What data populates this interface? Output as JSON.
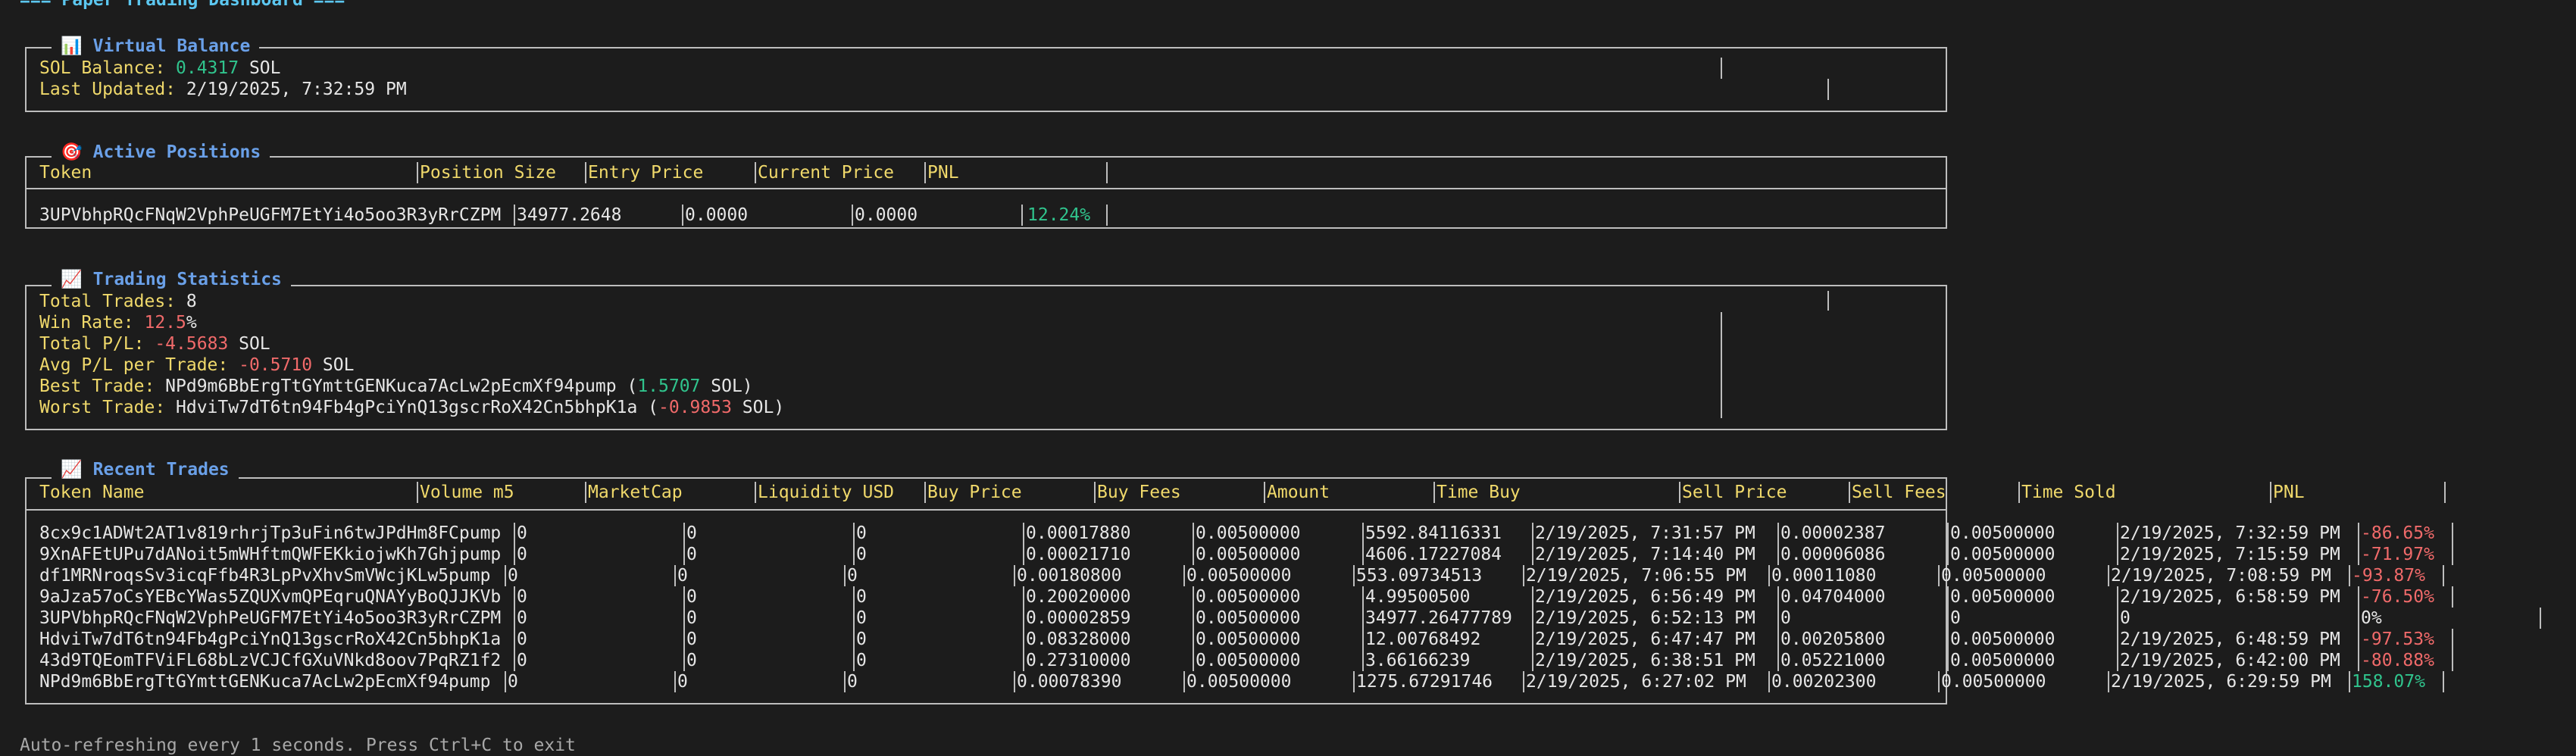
{
  "title": "=== Paper Trading Dashboard ===",
  "balance": {
    "legend": "Virtual Balance",
    "icon": "📊",
    "sol_label": "SOL Balance: ",
    "sol_value": "0.4317",
    "sol_unit": " SOL",
    "updated_label": "Last Updated: ",
    "updated_value": "2/19/2025, 7:32:59 PM"
  },
  "positions": {
    "legend": "Active Positions",
    "icon": "🎯",
    "headers": [
      "Token",
      "Position Size",
      "Entry Price",
      "Current Price",
      "PNL"
    ],
    "rows": [
      [
        "3UPVbhpRQcFNqW2VphPeUGFM7EtYi4o5oo3R3yRrCZPM",
        "34977.2648",
        "0.0000",
        "0.0000",
        "12.24%"
      ]
    ]
  },
  "stats": {
    "legend": "Trading Statistics",
    "icon": "📈",
    "total_trades_label": "Total Trades: ",
    "total_trades_value": "8",
    "win_rate_label": "Win Rate: ",
    "win_rate_value": "12.5",
    "win_rate_unit": "%",
    "total_pl_label": "Total P/L: ",
    "total_pl_value": "-4.5683",
    "total_pl_unit": " SOL",
    "avg_pl_label": "Avg P/L per Trade: ",
    "avg_pl_value": "-0.5710",
    "avg_pl_unit": " SOL",
    "best_label": "Best Trade: ",
    "best_token": "NPd9m6BbErgTtGYmttGENKuca7AcLw2pEcmXf94pump",
    "best_open": " (",
    "best_value": "1.5707",
    "best_close": " SOL)",
    "worst_label": "Worst Trade: ",
    "worst_token": "HdviTw7dT6tn94Fb4gPciYnQ13gscrRoX42Cn5bhpK1a",
    "worst_open": " (",
    "worst_value": "-0.9853",
    "worst_close": " SOL)"
  },
  "trades": {
    "legend": "Recent Trades",
    "icon": "📈",
    "headers": [
      "Token Name",
      "Volume m5",
      "MarketCap",
      "Liquidity USD",
      "Buy Price",
      "Buy Fees",
      "Amount",
      "Time Buy",
      "Sell Price",
      "Sell Fees",
      "Time Sold",
      "PNL"
    ],
    "rows": [
      [
        "8cx9c1ADWt2AT1v819rhrjTp3uFin6twJPdHm8FCpump",
        "0",
        "0",
        "0",
        "0.00017880",
        "0.00500000",
        "5592.84116331",
        "2/19/2025, 7:31:57 PM",
        "0.00002387",
        "0.00500000",
        "2/19/2025, 7:32:59 PM",
        "-86.65%"
      ],
      [
        "9XnAFEtUPu7dANoit5mWHftmQWFEKkiojwKh7Ghjpump",
        "0",
        "0",
        "0",
        "0.00021710",
        "0.00500000",
        "4606.17227084",
        "2/19/2025, 7:14:40 PM",
        "0.00006086",
        "0.00500000",
        "2/19/2025, 7:15:59 PM",
        "-71.97%"
      ],
      [
        "df1MRNroqsSv3icqFfb4R3LpPvXhvSmVWcjKLw5pump",
        "0",
        "0",
        "0",
        "0.00180800",
        "0.00500000",
        "553.09734513",
        "2/19/2025, 7:06:55 PM",
        "0.00011080",
        "0.00500000",
        "2/19/2025, 7:08:59 PM",
        "-93.87%"
      ],
      [
        "9aJza57oCsYEBcYWas5ZQUXvmQPEqruQNAYyBoQJJKVb",
        "0",
        "0",
        "0",
        "0.20020000",
        "0.00500000",
        "4.99500500",
        "2/19/2025, 6:56:49 PM",
        "0.04704000",
        "0.00500000",
        "2/19/2025, 6:58:59 PM",
        "-76.50%"
      ],
      [
        "3UPVbhpRQcFNqW2VphPeUGFM7EtYi4o5oo3R3yRrCZPM",
        "0",
        "0",
        "0",
        "0.00002859",
        "0.00500000",
        "34977.26477789",
        "2/19/2025, 6:52:13 PM",
        "0",
        "0",
        "0",
        "0%"
      ],
      [
        "HdviTw7dT6tn94Fb4gPciYnQ13gscrRoX42Cn5bhpK1a",
        "0",
        "0",
        "0",
        "0.08328000",
        "0.00500000",
        "12.00768492",
        "2/19/2025, 6:47:47 PM",
        "0.00205800",
        "0.00500000",
        "2/19/2025, 6:48:59 PM",
        "-97.53%"
      ],
      [
        "43d9TQEomTFViFL68bLzVCJCfGXuVNkd8oov7PqRZ1f2",
        "0",
        "0",
        "0",
        "0.27310000",
        "0.00500000",
        "3.66166239",
        "2/19/2025, 6:38:51 PM",
        "0.05221000",
        "0.00500000",
        "2/19/2025, 6:42:00 PM",
        "-80.88%"
      ],
      [
        "NPd9m6BbErgTtGYmttGENKuca7AcLw2pEcmXf94pump",
        "0",
        "0",
        "0",
        "0.00078390",
        "0.00500000",
        "1275.67291746",
        "2/19/2025, 6:27:02 PM",
        "0.00202300",
        "0.00500000",
        "2/19/2025, 6:29:59 PM",
        "158.07%"
      ]
    ]
  },
  "footer": "Auto-refreshing every 1 seconds. Press Ctrl+C to exit",
  "colors": {
    "background": "#1c1c1c",
    "label": "#f0d96b",
    "positive": "#30c48d",
    "negative": "#f06a6a",
    "title": "#5cc7f0",
    "legend": "#6aa0e8"
  }
}
